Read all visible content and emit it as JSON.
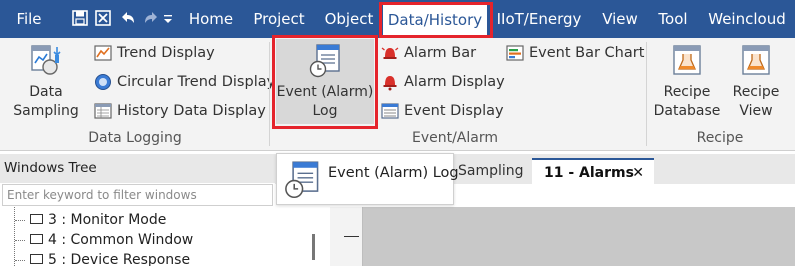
{
  "menu": {
    "file": "File",
    "home": "Home",
    "project": "Project",
    "object": "Object",
    "data_history": "Data/History",
    "iiot_energy": "IIoT/Energy",
    "view": "View",
    "tool": "Tool",
    "weincloud": "Weincloud"
  },
  "ribbon": {
    "data_sampling": [
      "Data",
      "Sampling"
    ],
    "trend_display": "Trend Display",
    "circular_trend_display": "Circular Trend Display",
    "history_data_display": "History Data Display",
    "data_logging_group": "Data Logging",
    "event_alarm_log": [
      "Event (Alarm)",
      "Log"
    ],
    "alarm_bar": "Alarm Bar",
    "alarm_display": "Alarm Display",
    "event_display": "Event Display",
    "event_bar_chart": "Event Bar Chart",
    "event_alarm_group": "Event/Alarm",
    "recipe_database": [
      "Recipe",
      "Database"
    ],
    "recipe_view": [
      "Recipe",
      "View"
    ],
    "recipe_group": "Recipe"
  },
  "windows_tree": {
    "title": "Windows Tree",
    "filter_placeholder": "Enter keyword to filter windows",
    "items": [
      "3 : Monitor Mode",
      "4 : Common Window",
      "5 : Device Response"
    ]
  },
  "tabs": {
    "sampling": "Sampling",
    "alarms": "11 - Alarms",
    "close": "✕"
  },
  "tooltip": {
    "label": "Event (Alarm) Log"
  },
  "colors": {
    "menu_bar": "#2b5797",
    "highlight_outline": "#e5242c",
    "ribbon_bg": "#f3f3f3"
  }
}
